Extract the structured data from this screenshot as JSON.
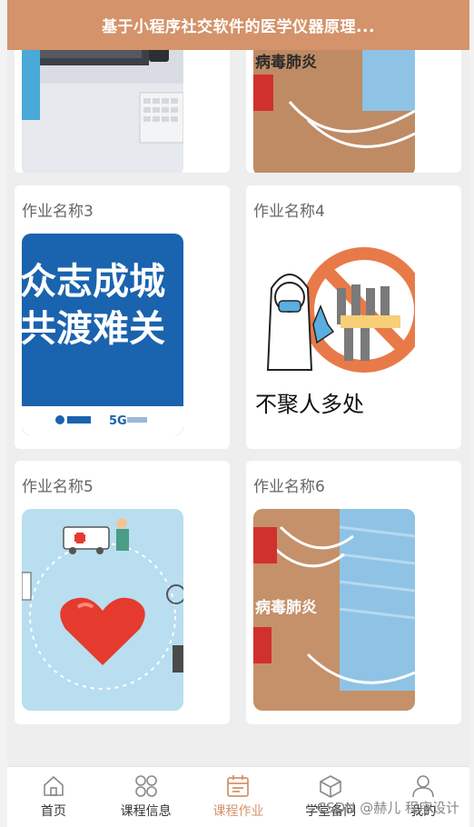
{
  "header": {
    "title": "基于小程序社交软件的医学仪器原理..."
  },
  "cards": [
    {
      "title": "",
      "image": "laptop-desk"
    },
    {
      "title": "",
      "image": "mask-pneumonia",
      "image_text": "病毒肺炎"
    },
    {
      "title": "作业名称3",
      "image": "poster-unite",
      "image_text_1": "众志成城",
      "image_text_2": "共渡难关"
    },
    {
      "title": "作业名称4",
      "image": "no-gathering",
      "image_text": "不聚人多处"
    },
    {
      "title": "作业名称5",
      "image": "health-heart"
    },
    {
      "title": "作业名称6",
      "image": "mask-pneumonia",
      "image_text": "病毒肺炎"
    }
  ],
  "tabbar": {
    "items": [
      {
        "label": "首页",
        "icon": "home-icon",
        "active": false
      },
      {
        "label": "课程信息",
        "icon": "grid-icon",
        "active": false
      },
      {
        "label": "课程作业",
        "icon": "calendar-icon",
        "active": true
      },
      {
        "label": "学堂备问",
        "icon": "box-icon",
        "active": false
      },
      {
        "label": "我的",
        "icon": "user-icon",
        "active": false
      }
    ],
    "active_color": "#d4936a"
  },
  "watermark": "CSDN @赫儿 程序设计",
  "colors": {
    "header": "#d4936a",
    "accent": "#d4936a"
  }
}
